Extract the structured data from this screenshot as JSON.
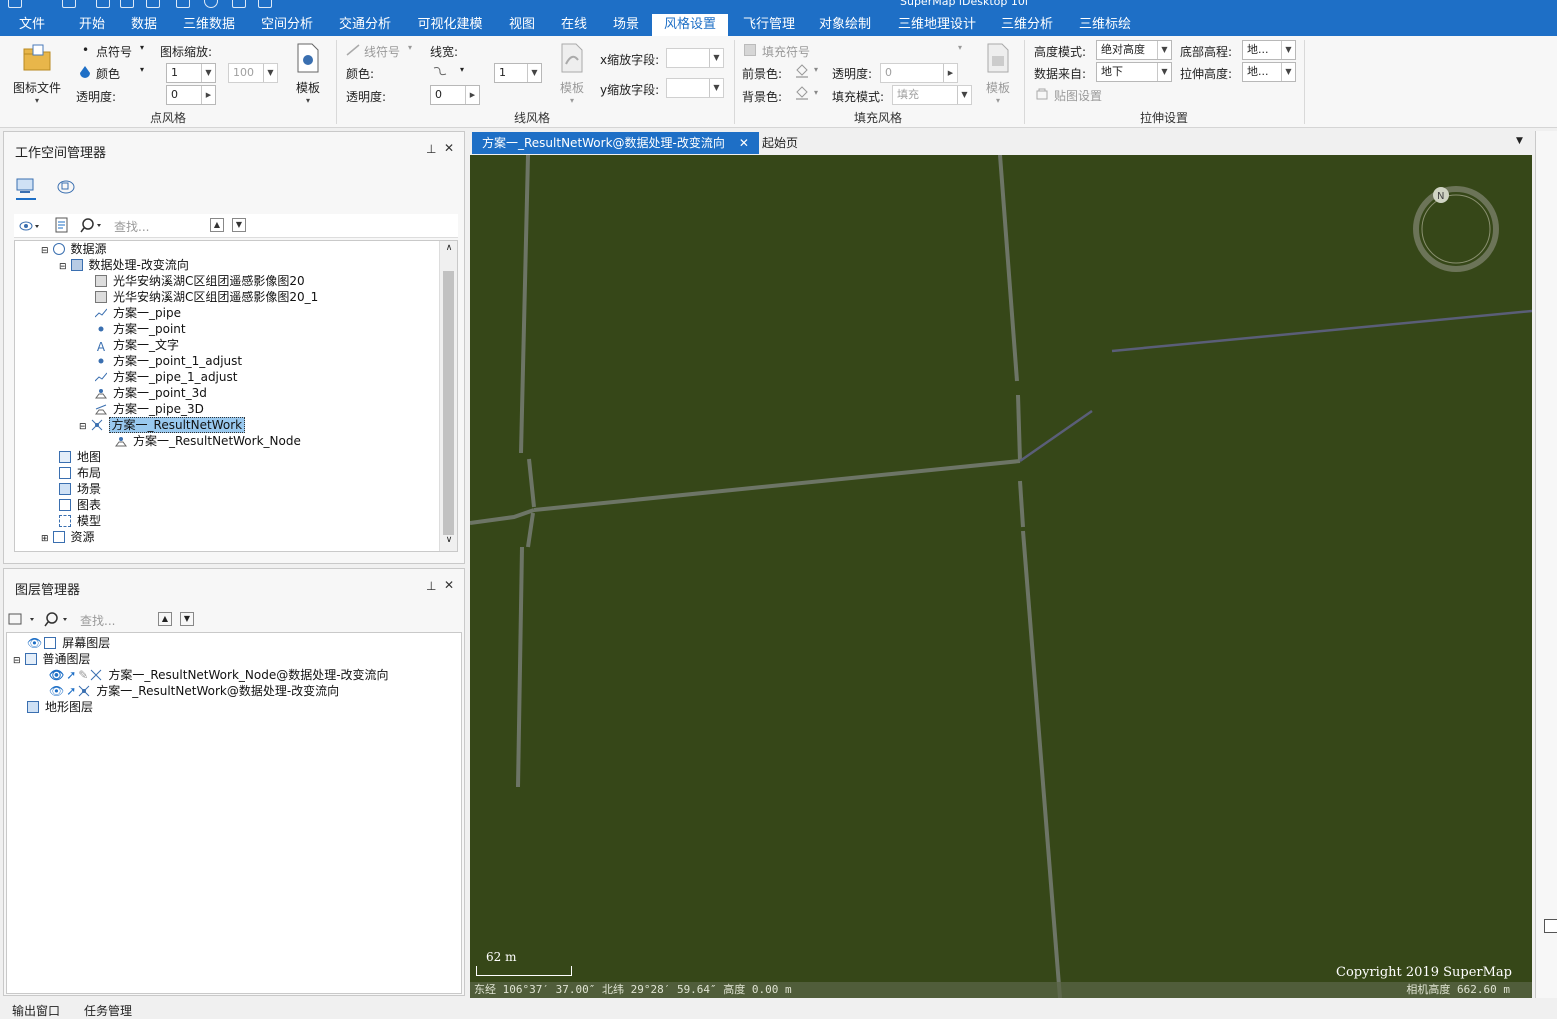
{
  "window": {
    "title": "SuperMap iDesktop 10i"
  },
  "menu": {
    "items": [
      {
        "label": "文件"
      },
      {
        "label": "开始"
      },
      {
        "label": "数据"
      },
      {
        "label": "三维数据"
      },
      {
        "label": "空间分析"
      },
      {
        "label": "交通分析"
      },
      {
        "label": "可视化建模"
      },
      {
        "label": "视图"
      },
      {
        "label": "在线"
      },
      {
        "label": "场景"
      },
      {
        "label": "风格设置"
      },
      {
        "label": "飞行管理"
      },
      {
        "label": "对象绘制"
      },
      {
        "label": "三维地理设计"
      },
      {
        "label": "三维分析"
      },
      {
        "label": "三维标绘"
      }
    ],
    "active": "风格设置"
  },
  "ribbon": {
    "point_style": {
      "group_title": "点风格",
      "icon_file": "图标文件",
      "point_symbol": "点符号",
      "color": "颜色",
      "opacity": "透明度:",
      "icon_scale": "图标缩放:",
      "scale_value": "1",
      "scale_value2": "100",
      "opacity_value": "0",
      "template": "模板"
    },
    "line_style": {
      "group_title": "线风格",
      "line_symbol": "线符号",
      "line_width": "线宽:",
      "color": "颜色:",
      "opacity": "透明度:",
      "width_value": "1",
      "opacity_value": "0",
      "template": "模板",
      "x_scale_field": "x缩放字段:",
      "y_scale_field": "y缩放字段:"
    },
    "fill_style": {
      "group_title": "填充风格",
      "fill_symbol": "填充符号",
      "foreground": "前景色:",
      "background": "背景色:",
      "opacity": "透明度:",
      "opacity_value": "0",
      "fill_mode": "填充模式:",
      "fill_mode_value": "填充",
      "template": "模板"
    },
    "extrude": {
      "group_title": "拉伸设置",
      "height_mode": "高度模式:",
      "height_mode_value": "绝对高度",
      "data_from": "数据来自:",
      "data_from_value": "地下",
      "bottom_elev": "底部高程:",
      "bottom_elev_value": "地...",
      "extrude_height": "拉伸高度:",
      "extrude_height_value": "地...",
      "texture": "贴图设置"
    }
  },
  "workspace": {
    "title": "工作空间管理器",
    "search_placeholder": "查找...",
    "tree": [
      {
        "label": "数据源"
      },
      {
        "label": "数据处理-改变流向"
      },
      {
        "label": "光华安纳溪湖C区组团遥感影像图20"
      },
      {
        "label": "光华安纳溪湖C区组团遥感影像图20_1"
      },
      {
        "label": "方案一_pipe"
      },
      {
        "label": "方案一_point"
      },
      {
        "label": "方案一_文字"
      },
      {
        "label": "方案一_point_1_adjust"
      },
      {
        "label": "方案一_pipe_1_adjust"
      },
      {
        "label": "方案一_point_3d"
      },
      {
        "label": "方案一_pipe_3D"
      },
      {
        "label": "方案一_ResultNetWork"
      },
      {
        "label": "方案一_ResultNetWork_Node"
      },
      {
        "label": "地图"
      },
      {
        "label": "布局"
      },
      {
        "label": "场景"
      },
      {
        "label": "图表"
      },
      {
        "label": "模型"
      },
      {
        "label": "资源"
      }
    ]
  },
  "layers": {
    "title": "图层管理器",
    "search_placeholder": "查找...",
    "tree": [
      {
        "label": "屏幕图层"
      },
      {
        "label": "普通图层"
      },
      {
        "label": "方案一_ResultNetWork_Node@数据处理-改变流向"
      },
      {
        "label": "方案一_ResultNetWork@数据处理-改变流向"
      },
      {
        "label": "地形图层"
      }
    ]
  },
  "map": {
    "tabs": [
      {
        "label": "方案一_ResultNetWork@数据处理-改变流向"
      },
      {
        "label": "起始页"
      }
    ],
    "close_glyph": "✕",
    "scale_text": "62 m",
    "copyright": "Copyright 2019 SuperMap",
    "status_left": "东经 106°37′ 37.00″   北纬 29°28′ 59.64″   高度 0.00 m",
    "status_right": "相机高度 662.60 m",
    "compass_label": "N"
  },
  "bottom_tabs": [
    {
      "label": "输出窗口"
    },
    {
      "label": "任务管理"
    }
  ],
  "colors": {
    "accent": "#1e6fc6",
    "map_bg": "#364718",
    "pipe": "#6b7260",
    "selection": "#99c9ef"
  }
}
